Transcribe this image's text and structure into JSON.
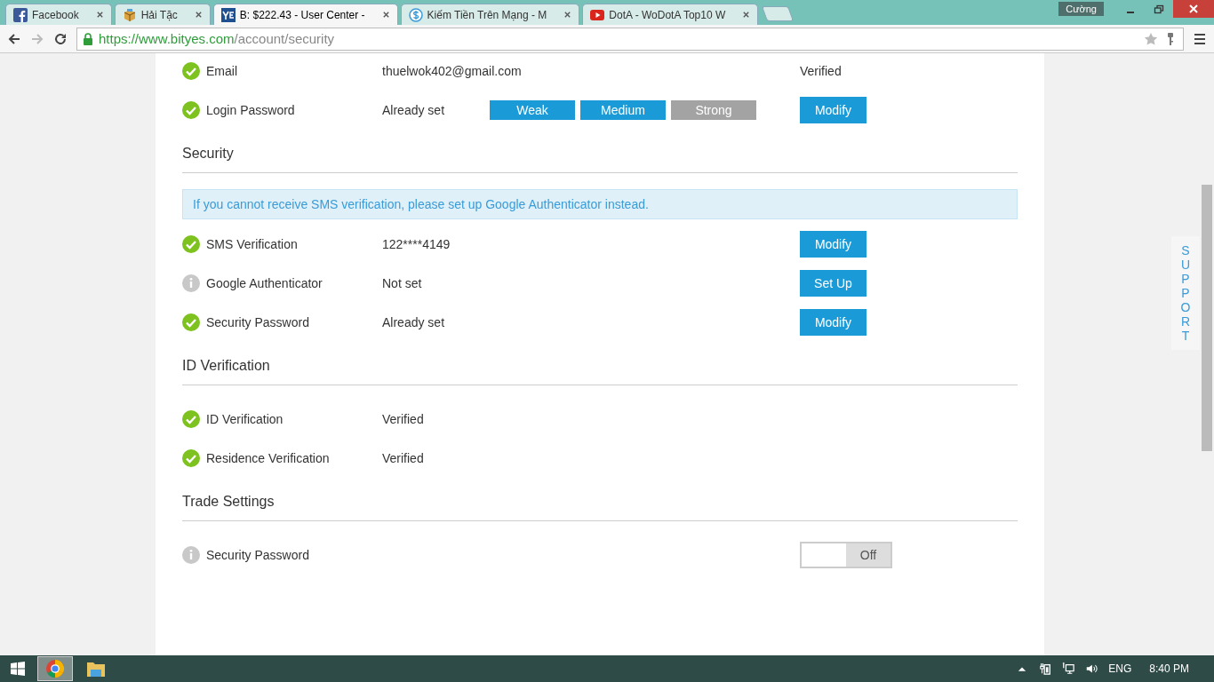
{
  "browser": {
    "tabs": [
      {
        "title": "Facebook",
        "kind": "facebook",
        "selected": false
      },
      {
        "title": "Hải Tặc",
        "kind": "box",
        "selected": false
      },
      {
        "title": "B: $222.43 - User Center -",
        "kind": "logo",
        "selected": true
      },
      {
        "title": "Kiếm Tiền Trên Mạng - M",
        "kind": "dollar",
        "selected": false
      },
      {
        "title": "DotA - WoDotA Top10 W",
        "kind": "video",
        "selected": false
      }
    ],
    "profile": "Cường",
    "url": {
      "host": "https://www.bityes.com",
      "path": "/account/security"
    }
  },
  "account_rows": [
    {
      "kind": "check",
      "label": "Email",
      "value": "thuelwok402@gmail.com",
      "note": "Verified"
    },
    {
      "kind": "check",
      "label": "Login Password",
      "value": "Already set",
      "strength": [
        {
          "label": "Weak",
          "on": true
        },
        {
          "label": "Medium",
          "on": true
        },
        {
          "label": "Strong",
          "on": false
        }
      ],
      "button": "Modify"
    }
  ],
  "sections": [
    {
      "title": "Security",
      "notice": "If you cannot receive SMS verification, please set up Google Authenticator instead.",
      "rows": [
        {
          "kind": "check",
          "label": "SMS Verification",
          "value": "122****4149",
          "button": "Modify"
        },
        {
          "kind": "info",
          "label": "Google Authenticator",
          "value": "Not set",
          "button": "Set Up"
        },
        {
          "kind": "check",
          "label": "Security Password",
          "value": "Already set",
          "button": "Modify"
        }
      ]
    },
    {
      "title": "ID Verification",
      "rows": [
        {
          "kind": "check",
          "label": "ID Verification",
          "value": "Verified"
        },
        {
          "kind": "check",
          "label": "Residence Verification",
          "value": "Verified"
        }
      ]
    },
    {
      "title": "Trade Settings",
      "rows": [
        {
          "kind": "info",
          "label": "Security Password",
          "toggle": {
            "on": false,
            "label": "Off"
          }
        }
      ]
    }
  ],
  "support": "SUPPORT",
  "taskbar": {
    "language": "ENG",
    "time": "8:40 PM"
  }
}
